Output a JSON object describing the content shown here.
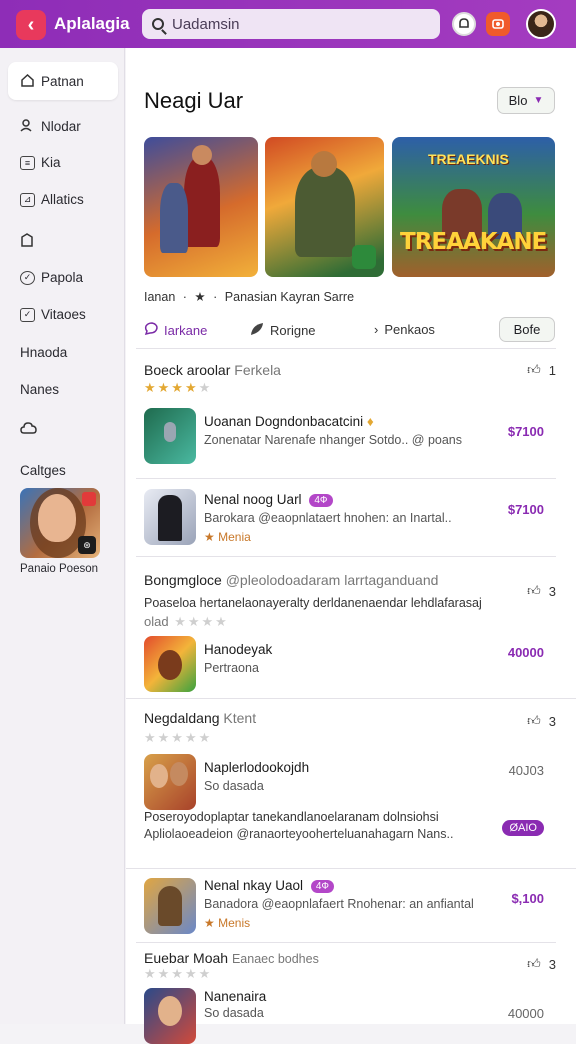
{
  "app": {
    "brand": "Aplalagia"
  },
  "search": {
    "placeholder": "Uadamsin"
  },
  "sidebar": {
    "items": [
      {
        "label": "Patnan"
      },
      {
        "label": "Nlodar"
      },
      {
        "label": "Kia"
      },
      {
        "label": "Allatics"
      },
      {
        "label": ""
      },
      {
        "label": "Papola"
      },
      {
        "label": "Vitaoes"
      },
      {
        "label": "Hnaoda"
      },
      {
        "label": "Nanes"
      },
      {
        "label": ""
      }
    ],
    "section": "Caltges",
    "featured_label": "Panaio Poeson"
  },
  "main": {
    "title": "Neagi Uar",
    "title_button": "Blo",
    "caption_prefix": "Ianan",
    "caption": "Panasian Kayran Sarre",
    "banner3_logo": "TREAAKANE",
    "banner3_top": "TREAEKNIS",
    "tabs": [
      {
        "label": "Iarkane"
      },
      {
        "label": "Rorigne"
      },
      {
        "label": "Penkaos"
      }
    ],
    "tab_button": "Bofe",
    "sections": [
      {
        "head": "Boeck aroolar",
        "head_sub": "Ferkela",
        "count": "1",
        "apps": [
          {
            "title": "Uoanan Dogndonbacatcini",
            "desc": "Zonenatar Narenafe nhanger Sotdo.. @ poans",
            "price": "$7100"
          },
          {
            "title": "Nenal noog Uarl",
            "tag": "4Ф",
            "desc": "Barokara @eaopnlataert hnohen: an Inartal..",
            "note": "Menia",
            "price": "$7100"
          }
        ]
      },
      {
        "head": "Bongmgloce",
        "head_sub": "@pleolodoadaram larrtaganduand",
        "count": "3",
        "long": "Poaseloa hertanelaonayeralty derldanenaendar lehdlafarasaj",
        "long2": "olad",
        "apps": [
          {
            "title": "Hanodeyak",
            "desc": "Pertraona",
            "price": "40000"
          }
        ]
      },
      {
        "head": "Negdaldang",
        "head_sub": "Ktent",
        "count": "3",
        "apps": [
          {
            "title": "Naplerlodookojdh",
            "desc": "So dasada",
            "price": "40J03"
          }
        ],
        "long": "Poseroyodoplaptar tanekandlanoelaranam dolnsiohsi",
        "long2": "Apliolaoeadeion @ranaorteyooherteluanahagarn Nans..",
        "pill": "ØAIO"
      },
      {
        "head": "",
        "apps": [
          {
            "title": "Nenal nkay Uaol",
            "tag": "4Ф",
            "desc": "Banadora @eaopnlafaert Rnohenar: an anfiantal",
            "note": "Menis",
            "price": "$,100"
          }
        ]
      },
      {
        "head": "Euebar Moah",
        "head_sub": "Eanaec bodhes",
        "count": "3",
        "apps": [
          {
            "title": "Nanenaira",
            "desc": "So dasada",
            "price": "40000"
          }
        ]
      }
    ]
  },
  "colors": {
    "accent": "#8e2db7",
    "back": "#e8395c",
    "price": "#8a2bb2",
    "star": "#e3a833"
  }
}
